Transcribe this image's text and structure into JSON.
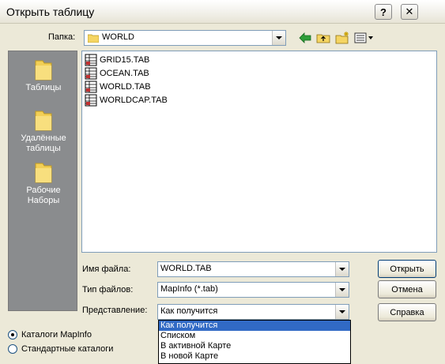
{
  "window": {
    "title": "Открыть таблицу"
  },
  "toolbar": {
    "lookin_label": "Папка:",
    "lookin_value": "WORLD",
    "icons": [
      "back-icon",
      "up-folder-icon",
      "new-folder-icon",
      "views-menu-icon"
    ]
  },
  "places": [
    {
      "label_line1": "Таблицы",
      "label_line2": ""
    },
    {
      "label_line1": "Удалённые",
      "label_line2": "таблицы"
    },
    {
      "label_line1": "Рабочие",
      "label_line2": "Наборы"
    }
  ],
  "files": [
    {
      "name": "GRID15.TAB"
    },
    {
      "name": "OCEAN.TAB"
    },
    {
      "name": "WORLD.TAB"
    },
    {
      "name": "WORLDCAP.TAB"
    }
  ],
  "fields": {
    "filename_label": "Имя файла:",
    "filename_value": "WORLD.TAB",
    "filetype_label": "Тип файлов:",
    "filetype_value": "MapInfo (*.tab)",
    "view_label": "Представление:",
    "view_value": "Как получится"
  },
  "buttons": {
    "open": "Открыть",
    "cancel": "Отмена",
    "help": "Справка"
  },
  "view_options": [
    "Как получится",
    "Списком",
    "В активной Карте",
    "В новой Карте"
  ],
  "radios": [
    {
      "label": "Каталоги MapInfo",
      "selected": true
    },
    {
      "label": "Стандартные каталоги",
      "selected": false
    }
  ],
  "colors": {
    "selection": "#316ac5",
    "places_bg": "#8a8c8e",
    "dialog_bg": "#ece9d8"
  }
}
